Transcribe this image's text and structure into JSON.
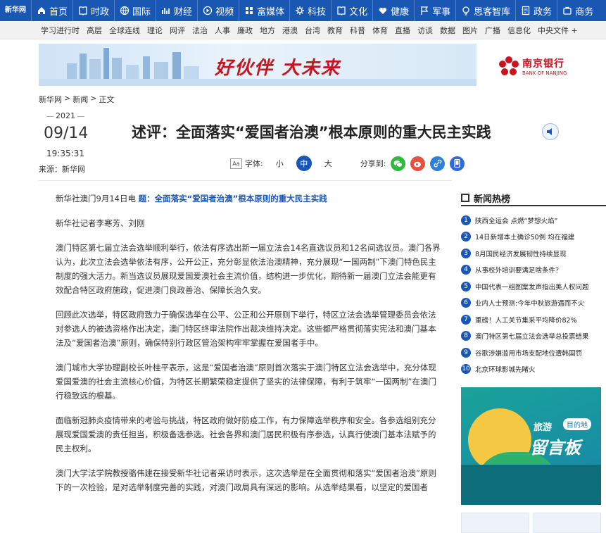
{
  "topnav": {
    "logo": "新华网",
    "items": [
      {
        "label": "首页",
        "icon": "home-icon"
      },
      {
        "label": "时政",
        "icon": "book-icon"
      },
      {
        "label": "国际",
        "icon": "globe-icon"
      },
      {
        "label": "财经",
        "icon": "chart-icon"
      },
      {
        "label": "视频",
        "icon": "play-icon"
      },
      {
        "label": "富媒体",
        "icon": "grid-icon"
      },
      {
        "label": "科技",
        "icon": "gear-icon"
      },
      {
        "label": "文化",
        "icon": "book-icon"
      },
      {
        "label": "健康",
        "icon": "heart-icon"
      },
      {
        "label": "军事",
        "icon": "flag-icon"
      },
      {
        "label": "思客智库",
        "icon": "bulb-icon"
      },
      {
        "label": "政务",
        "icon": "doc-icon"
      },
      {
        "label": "商务",
        "icon": "bag-icon"
      }
    ]
  },
  "subnav": [
    "学习进行时",
    "高层",
    "全球连线",
    "理论",
    "网评",
    "法治",
    "人事",
    "廉政",
    "地方",
    "港澳",
    "台湾",
    "教育",
    "科普",
    "体育",
    "直播",
    "访谈",
    "数据",
    "图片",
    "广播",
    "信息化",
    "中央文件 +"
  ],
  "banner": {
    "slogan": "好伙伴 大未来"
  },
  "bank": {
    "cn": "南京银行",
    "en": "BANK OF NANJING"
  },
  "breadcrumb": [
    "新华网",
    "新闻",
    "正文"
  ],
  "date": {
    "year": "2021",
    "day": "09/14",
    "time": "19:35:31",
    "source": "来源：新华网"
  },
  "title": "述评：全面落实“爱国者治澳”根本原则的重大民主实践",
  "tools": {
    "font_label": "字体:",
    "small": "小",
    "mid": "中",
    "large": "大",
    "share_label": "分享到:"
  },
  "article": {
    "lead_prefix": "新华社澳门9月14日电 ",
    "lead_title": "题：全面落实“爱国者治澳”根本原则的重大民主实践",
    "reporters": "新华社记者李寒芳、刘刚",
    "paragraphs": [
      "澳门特区第七届立法会选举顺利举行，依法有序选出新一届立法会14名直选议员和12名间选议员。澳门各界认为，此次立法会选举依法有序，公开公正，充分彰显依法治澳精神，充分展现“一国两制”下澳门特色民主制度的强大活力。新当选议员展现爱国爱澳社会主流价值，结构进一步优化，期待新一届澳门立法会能更有效配合特区政府施政，促进澳门良政善治、保障长治久安。",
      "回顾此次选举，特区政府致力于确保选举在公平、公正和公开原则下举行，特区立法会选举管理委员会依法对参选人的被选资格作出决定，澳门特区终审法院作出裁决维持决定。这些都严格贯彻落实宪法和澳门基本法及“爱国者治澳”原则，确保特别行政区管治架构牢牢掌握在爱国者手中。",
      "澳门城市大学协理副校长叶桂平表示，这是“爱国者治澳”原则首次落实于澳门特区立法会选举中，充分体现爱国爱澳的社会主流核心价值，为特区长期繁荣稳定提供了坚实的法律保障，有利于筑牢“一国两制”在澳门行稳致远的根基。",
      "面临新冠肺炎疫情带来的考验与挑战，特区政府做好防疫工作，有力保障选举秩序和安全。各参选组别充分展现爱国爱澳的责任担当，积极备选参选。社会各界和澳门居民积极有序参选，认真行使澳门基本法赋予的民主权利。",
      "澳门大学法学院教授骆伟建在接受新华社记者采访时表示，这次选举是在全面贯彻和落实“爱国者治澳”原则下的一次检验，是对选举制度完善的实践，对澳门政局具有深远的影响。从选举结果看，以坚定的爱国者"
    ]
  },
  "hot": {
    "heading": "新闻热榜",
    "items": [
      "陕西全运会 点燃“梦想火焰”",
      "14日新增本土确诊50例 均在福建",
      "8月国民经济发展韧性持续显现",
      "从事校外培训要满足啥条件？",
      "中国代表一组图案发声指出美人权问题",
      "业内人士预测:今年中秋旅游遇而不火",
      "重磅！人工关节集采平均降价82%",
      "澳门特区第七届立法会选举总投票结果",
      "谷歌涉嫌滥用市场支配地位遭韩国罚",
      "北京环球影城先睹火"
    ]
  },
  "ad": {
    "t1": "旅游",
    "pill": "目的地",
    "t2": "留言板"
  }
}
